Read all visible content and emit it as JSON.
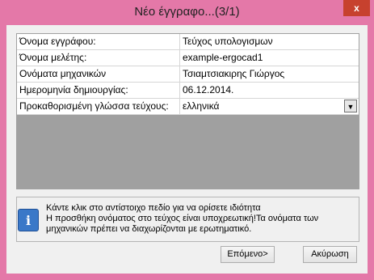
{
  "window": {
    "title": "Νέο έγγραφο...(3/1)",
    "close_label": "x"
  },
  "grid": {
    "rows": [
      {
        "label": "Όνομα εγγράφου:",
        "value": "Τεύχος υπολογισμων"
      },
      {
        "label": "Όνομα μελέτης:",
        "value": "example-ergocad1"
      },
      {
        "label": "Ονόματα μηχανικών",
        "value": "Τσιαμτσιακιρης Γιώργος"
      },
      {
        "label": "Ημερομηνία δημιουργίας:",
        "value": "06.12.2014."
      },
      {
        "label": "Προκαθορισμένη γλώσσα τεύχους:",
        "value": "ελληνικά"
      }
    ]
  },
  "info": {
    "icon": "info-icon",
    "line1": "Κάντε κλικ στο αντίστοιχο πεδίο για να ορίσετε ιδιότητα",
    "line2": "Η προσθήκη ονόματος στο τεύχος είναι υποχρεωτική!Τα ονόματα των",
    "line3": "μηχανικών πρέπει να διαχωρίζονται με ερωτηματικό."
  },
  "buttons": {
    "next": "Επόμενο>",
    "cancel": "Ακύρωση"
  },
  "colors": {
    "frame": "#e478a8",
    "close": "#c7412e",
    "grid_empty": "#a0a0a0"
  }
}
